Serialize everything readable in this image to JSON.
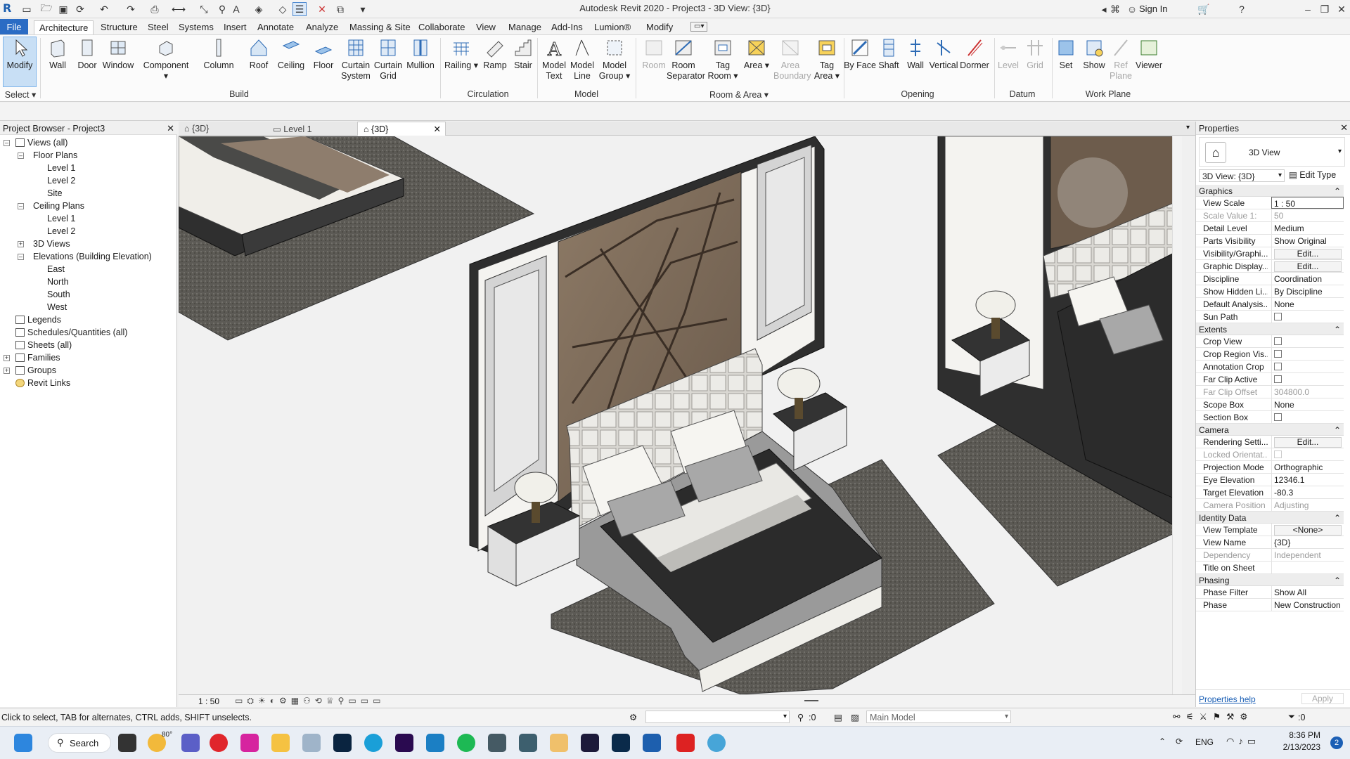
{
  "window": {
    "title": "Autodesk Revit 2020 - Project3 - 3D View: {3D}",
    "sign_in": "Sign In"
  },
  "ribbon_tabs": [
    "File",
    "Architecture",
    "Structure",
    "Steel",
    "Systems",
    "Insert",
    "Annotate",
    "Analyze",
    "Massing & Site",
    "Collaborate",
    "View",
    "Manage",
    "Add-Ins",
    "Lumion®",
    "Modify"
  ],
  "ribbon": {
    "buttons": [
      {
        "label": "Modify"
      },
      {
        "label": "Wall"
      },
      {
        "label": "Door"
      },
      {
        "label": "Window"
      },
      {
        "label": "Component"
      },
      {
        "label": "Column"
      },
      {
        "label": "Roof"
      },
      {
        "label": "Ceiling"
      },
      {
        "label": "Floor"
      },
      {
        "label": "Curtain System"
      },
      {
        "label": "Curtain Grid"
      },
      {
        "label": "Mullion"
      },
      {
        "label": "Railing"
      },
      {
        "label": "Ramp"
      },
      {
        "label": "Stair"
      },
      {
        "label": "Model Text"
      },
      {
        "label": "Model Line"
      },
      {
        "label": "Model Group"
      },
      {
        "label": "Room"
      },
      {
        "label": "Room Separator"
      },
      {
        "label": "Tag Room"
      },
      {
        "label": "Area"
      },
      {
        "label": "Area Boundary"
      },
      {
        "label": "Tag Area"
      },
      {
        "label": "By Face"
      },
      {
        "label": "Shaft"
      },
      {
        "label": "Wall"
      },
      {
        "label": "Vertical"
      },
      {
        "label": "Dormer"
      },
      {
        "label": "Level"
      },
      {
        "label": "Grid"
      },
      {
        "label": "Set"
      },
      {
        "label": "Show"
      },
      {
        "label": "Ref Plane"
      },
      {
        "label": "Viewer"
      }
    ],
    "panels": [
      "Select",
      "Build",
      "Circulation",
      "Model",
      "Room & Area",
      "Opening",
      "Datum",
      "Work Plane"
    ]
  },
  "project_browser": {
    "title": "Project Browser - Project3",
    "items": [
      {
        "label": "Views (all)"
      },
      {
        "label": "Floor Plans"
      },
      {
        "label": "Level 1"
      },
      {
        "label": "Level 2"
      },
      {
        "label": "Site"
      },
      {
        "label": "Ceiling Plans"
      },
      {
        "label": "Level 1"
      },
      {
        "label": "Level 2"
      },
      {
        "label": "3D Views"
      },
      {
        "label": "Elevations (Building Elevation)"
      },
      {
        "label": "East"
      },
      {
        "label": "North"
      },
      {
        "label": "South"
      },
      {
        "label": "West"
      },
      {
        "label": "Legends"
      },
      {
        "label": "Schedules/Quantities (all)"
      },
      {
        "label": "Sheets (all)"
      },
      {
        "label": "Families"
      },
      {
        "label": "Groups"
      },
      {
        "label": "Revit Links"
      }
    ]
  },
  "view_tabs": [
    {
      "label": "{3D}"
    },
    {
      "label": "Level 1"
    },
    {
      "label": "{3D}"
    }
  ],
  "view_control": {
    "scale": "1 : 50"
  },
  "properties": {
    "title": "Properties",
    "type_name": "3D View",
    "selector": "3D View: {3D}",
    "edit_type": "Edit Type",
    "groups": {
      "graphics": "Graphics",
      "extents": "Extents",
      "camera": "Camera",
      "identity": "Identity Data",
      "phasing": "Phasing"
    },
    "rows": {
      "view_scale": {
        "name": "View Scale",
        "value": "1 : 50"
      },
      "scale_value": {
        "name": "Scale Value    1:",
        "value": "50"
      },
      "detail_level": {
        "name": "Detail Level",
        "value": "Medium"
      },
      "parts_visibility": {
        "name": "Parts Visibility",
        "value": "Show Original"
      },
      "visibility_graphics": {
        "name": "Visibility/Graphi...",
        "value": "Edit..."
      },
      "graphic_display": {
        "name": "Graphic Display...",
        "value": "Edit..."
      },
      "discipline": {
        "name": "Discipline",
        "value": "Coordination"
      },
      "show_hidden": {
        "name": "Show Hidden Li...",
        "value": "By Discipline"
      },
      "default_analysis": {
        "name": "Default Analysis...",
        "value": "None"
      },
      "sun_path": {
        "name": "Sun Path",
        "value": ""
      },
      "crop_view": {
        "name": "Crop View",
        "value": ""
      },
      "crop_region": {
        "name": "Crop Region Vis...",
        "value": ""
      },
      "annotation_crop": {
        "name": "Annotation Crop",
        "value": ""
      },
      "far_clip_active": {
        "name": "Far Clip Active",
        "value": ""
      },
      "far_clip_offset": {
        "name": "Far Clip Offset",
        "value": "304800.0"
      },
      "scope_box": {
        "name": "Scope Box",
        "value": "None"
      },
      "section_box": {
        "name": "Section Box",
        "value": ""
      },
      "rendering_settings": {
        "name": "Rendering Setti...",
        "value": "Edit..."
      },
      "locked_orientation": {
        "name": "Locked Orientat...",
        "value": ""
      },
      "projection_mode": {
        "name": "Projection Mode",
        "value": "Orthographic"
      },
      "eye_elevation": {
        "name": "Eye Elevation",
        "value": "12346.1"
      },
      "target_elevation": {
        "name": "Target Elevation",
        "value": "-80.3"
      },
      "camera_position": {
        "name": "Camera Position",
        "value": "Adjusting"
      },
      "view_template": {
        "name": "View Template",
        "value": "<None>"
      },
      "view_name": {
        "name": "View Name",
        "value": "{3D}"
      },
      "dependency": {
        "name": "Dependency",
        "value": "Independent"
      },
      "title_on_sheet": {
        "name": "Title on Sheet",
        "value": ""
      },
      "phase_filter": {
        "name": "Phase Filter",
        "value": "Show All"
      },
      "phase": {
        "name": "Phase",
        "value": "New Construction"
      }
    },
    "help_link": "Properties help",
    "apply": "Apply"
  },
  "status": {
    "hint": "Click to select, TAB for alternates, CTRL adds, SHIFT unselects.",
    "worksets": ":0",
    "model": "Main Model",
    "filter": ":0"
  },
  "taskbar": {
    "search": "Search",
    "weather": "80°",
    "lang": "ENG",
    "time": "8:36 PM",
    "date": "2/13/2023",
    "badge": "2"
  },
  "colors": {
    "accent": "#2b6cc4",
    "selected": "#c8dff5"
  }
}
